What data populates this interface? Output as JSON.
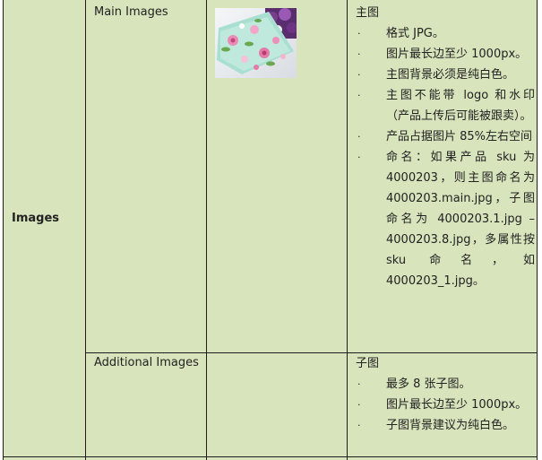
{
  "section": {
    "label": "Images"
  },
  "main_images": {
    "label": "Main Images",
    "title": "主图",
    "bullets": [
      {
        "text": "格式 JPG。"
      },
      {
        "text": "图片最长边至少 1000px。"
      },
      {
        "text": "主图背景必须是纯白色。"
      },
      {
        "text": "主图不能带 logo 和水印（产品上传后可能被跟卖）。"
      },
      {
        "text": "产品占据图片 85%左右空间"
      },
      {
        "text": "命名：如果产品 sku 为 4000203，则主图命名为 4000203.main.jpg，子图命名为 4000203.1.jpg – 4000203.8.jpg，多属性按 sku 命名，如 4000203_1.jpg。"
      }
    ]
  },
  "additional_images": {
    "label": "Additional Images",
    "title": "子图",
    "bullets": [
      {
        "text": "最多 8 张子图。"
      },
      {
        "text": "图片最长边至少 1000px。"
      },
      {
        "text": "子图背景建议为纯白色。"
      }
    ]
  },
  "bullet_symbol": "·",
  "colors": {
    "cell_background": "#d8e4bc",
    "grid_line": "#1f1f1f",
    "text": "#222222"
  }
}
